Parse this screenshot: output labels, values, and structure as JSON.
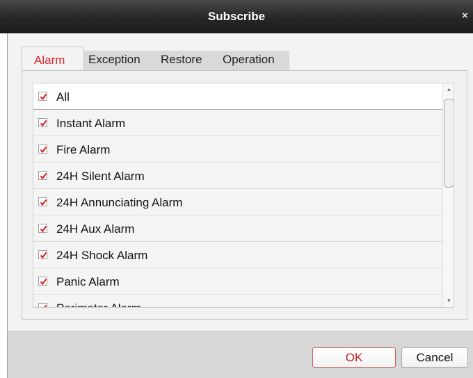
{
  "dialog": {
    "title": "Subscribe",
    "close_symbol": "×"
  },
  "tabs": [
    {
      "label": "Alarm",
      "active": true
    },
    {
      "label": "Exception",
      "active": false
    },
    {
      "label": "Restore",
      "active": false
    },
    {
      "label": "Operation",
      "active": false
    }
  ],
  "list": {
    "items": [
      {
        "label": "All",
        "checked": true
      },
      {
        "label": "Instant Alarm",
        "checked": true
      },
      {
        "label": "Fire Alarm",
        "checked": true
      },
      {
        "label": "24H Silent Alarm",
        "checked": true
      },
      {
        "label": "24H Annunciating Alarm",
        "checked": true
      },
      {
        "label": "24H Aux Alarm",
        "checked": true
      },
      {
        "label": "24H Shock Alarm",
        "checked": true
      },
      {
        "label": "Panic Alarm",
        "checked": true
      },
      {
        "label": "Perimeter Alarm",
        "checked": true
      }
    ]
  },
  "buttons": {
    "ok": "OK",
    "cancel": "Cancel"
  },
  "colors": {
    "accent": "#d9282a",
    "check": "#d9282a",
    "titlebar": "#262626"
  }
}
